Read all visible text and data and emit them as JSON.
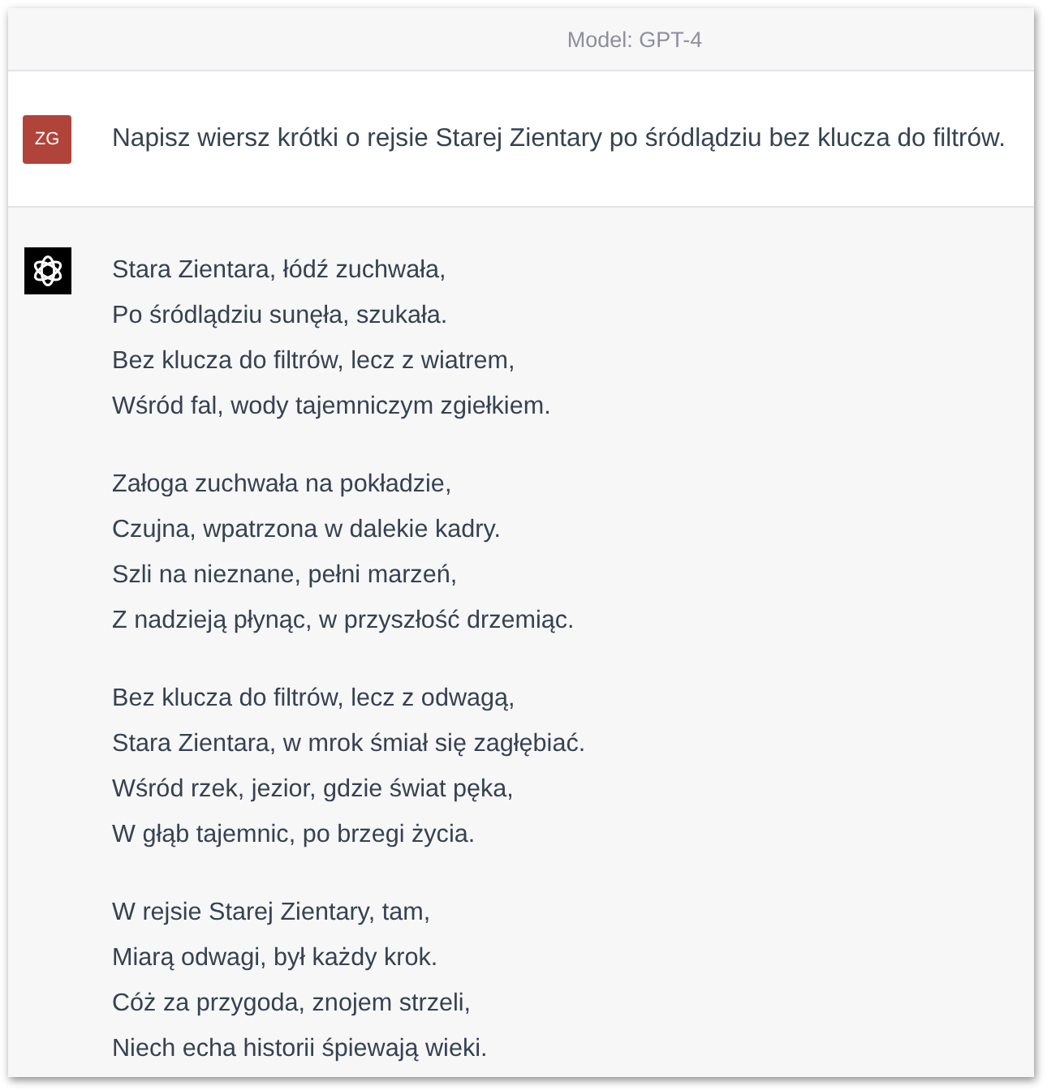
{
  "header": {
    "model_label": "Model: GPT-4"
  },
  "user_message": {
    "avatar_initials": "ZG",
    "text": "Napisz wiersz krótki o rejsie Starej Zientary po śródlądziu bez klucza do filtrów."
  },
  "assistant_message": {
    "stanzas": [
      [
        "Stara Zientara, łódź zuchwała,",
        "Po śródlądziu sunęła, szukała.",
        "Bez klucza do filtrów, lecz z wiatrem,",
        "Wśród fal, wody tajemniczym zgiełkiem."
      ],
      [
        "Załoga zuchwała na pokładzie,",
        "Czujna, wpatrzona w dalekie kadry.",
        "Szli na nieznane, pełni marzeń,",
        "Z nadzieją płynąc, w przyszłość drzemiąc."
      ],
      [
        "Bez klucza do filtrów, lecz z odwagą,",
        "Stara Zientara, w mrok śmiał się zagłębiać.",
        "Wśród rzek, jezior, gdzie świat pęka,",
        "W głąb tajemnic, po brzegi życia."
      ],
      [
        "W rejsie Starej Zientary, tam,",
        "Miarą odwagi, był każdy krok.",
        "Cóż za przygoda, znojem strzeli,",
        "Niech echa historii śpiewają wieki."
      ]
    ]
  }
}
